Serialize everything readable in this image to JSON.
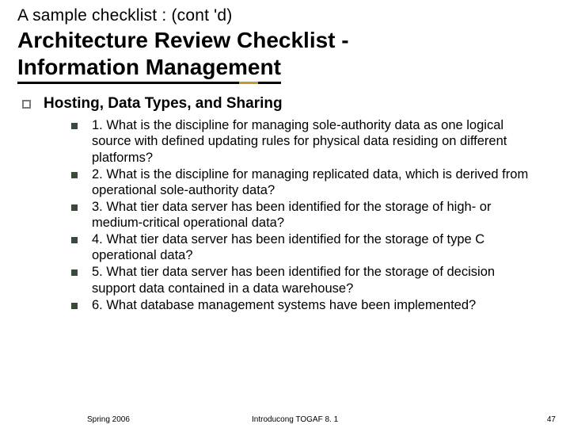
{
  "supertitle": "A sample checklist : (cont 'd)",
  "title_line1": "Architecture Review Checklist -",
  "title_line2": "Information Management",
  "section": {
    "heading": "Hosting, Data Types, and Sharing",
    "items": [
      "1. What is the discipline for managing sole-authority data as one logical source with defined updating rules for physical data residing on different platforms?",
      "2. What is the discipline for managing replicated data, which is derived from operational sole-authority data?",
      "3. What tier data server has been identified for the storage of high- or medium-critical operational data?",
      "4. What tier data server has been identified for the storage of type C operational data?",
      "5. What tier data server has been identified for the storage of decision support data contained in a data warehouse?",
      "6. What database management systems have been implemented?"
    ]
  },
  "footer": {
    "left": "Spring 2006",
    "center": "Introducong TOGAF 8. 1",
    "right": "47"
  }
}
